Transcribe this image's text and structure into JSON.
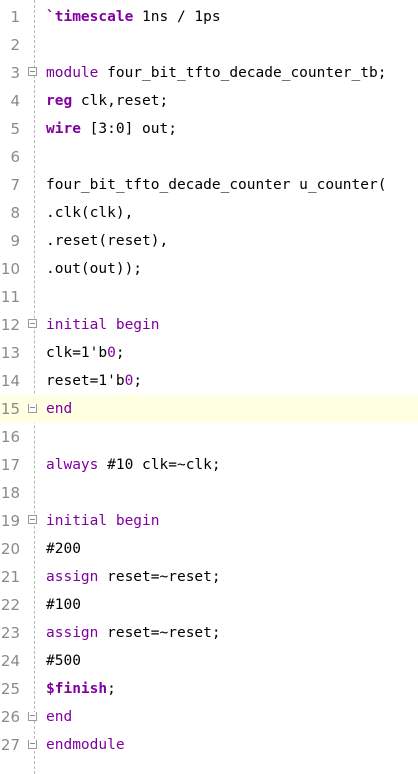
{
  "editor": {
    "lines": [
      {
        "n": "1",
        "segments": [
          {
            "t": "`timescale",
            "c": "kwb"
          },
          {
            "t": " 1ns / 1ps",
            "c": ""
          }
        ]
      },
      {
        "n": "2",
        "segments": []
      },
      {
        "n": "3",
        "fold": "open",
        "segments": [
          {
            "t": "module",
            "c": "kw"
          },
          {
            "t": " four_bit_tfto_decade_counter_tb;",
            "c": ""
          }
        ]
      },
      {
        "n": "4",
        "segments": [
          {
            "t": "reg",
            "c": "kwb"
          },
          {
            "t": " clk,reset;",
            "c": ""
          }
        ]
      },
      {
        "n": "5",
        "segments": [
          {
            "t": "wire",
            "c": "kwb"
          },
          {
            "t": " [3:0] out;",
            "c": ""
          }
        ]
      },
      {
        "n": "6",
        "segments": []
      },
      {
        "n": "7",
        "segments": [
          {
            "t": "four_bit_tfto_decade_counter u_counter(",
            "c": ""
          }
        ]
      },
      {
        "n": "8",
        "segments": [
          {
            "t": ".clk(clk),",
            "c": ""
          }
        ]
      },
      {
        "n": "9",
        "segments": [
          {
            "t": ".reset(reset),",
            "c": ""
          }
        ]
      },
      {
        "n": "10",
        "segments": [
          {
            "t": ".out(out));",
            "c": ""
          }
        ]
      },
      {
        "n": "11",
        "segments": []
      },
      {
        "n": "12",
        "fold": "open",
        "segments": [
          {
            "t": "initial begin",
            "c": "kw"
          }
        ]
      },
      {
        "n": "13",
        "segments": [
          {
            "t": "clk=1'b",
            "c": ""
          },
          {
            "t": "0",
            "c": "kw"
          },
          {
            "t": ";",
            "c": ""
          }
        ]
      },
      {
        "n": "14",
        "segments": [
          {
            "t": "reset=1'b",
            "c": ""
          },
          {
            "t": "0",
            "c": "kw"
          },
          {
            "t": ";",
            "c": ""
          }
        ]
      },
      {
        "n": "15",
        "fold": "close",
        "current": true,
        "segments": [
          {
            "t": "end",
            "c": "kw"
          }
        ]
      },
      {
        "n": "16",
        "segments": []
      },
      {
        "n": "17",
        "segments": [
          {
            "t": "always",
            "c": "kw"
          },
          {
            "t": " #10 clk=~clk;",
            "c": ""
          }
        ]
      },
      {
        "n": "18",
        "segments": []
      },
      {
        "n": "19",
        "fold": "open",
        "segments": [
          {
            "t": "initial begin",
            "c": "kw"
          }
        ]
      },
      {
        "n": "20",
        "segments": [
          {
            "t": "#200",
            "c": ""
          }
        ]
      },
      {
        "n": "21",
        "segments": [
          {
            "t": "assign",
            "c": "kw"
          },
          {
            "t": " reset=~reset;",
            "c": ""
          }
        ]
      },
      {
        "n": "22",
        "segments": [
          {
            "t": "#100",
            "c": ""
          }
        ]
      },
      {
        "n": "23",
        "segments": [
          {
            "t": "assign",
            "c": "kw"
          },
          {
            "t": " reset=~reset;",
            "c": ""
          }
        ]
      },
      {
        "n": "24",
        "segments": [
          {
            "t": "#500",
            "c": ""
          }
        ]
      },
      {
        "n": "25",
        "segments": [
          {
            "t": "$finish",
            "c": "kwb"
          },
          {
            "t": ";",
            "c": ""
          }
        ]
      },
      {
        "n": "26",
        "fold": "close",
        "segments": [
          {
            "t": "end",
            "c": "kw"
          }
        ]
      },
      {
        "n": "27",
        "fold": "close",
        "segments": [
          {
            "t": "endmodule",
            "c": "kw"
          }
        ]
      }
    ]
  },
  "colors": {
    "keyword": "#8000a0",
    "current_line_bg": "#ffffe1",
    "line_number": "#8a8a8a"
  }
}
